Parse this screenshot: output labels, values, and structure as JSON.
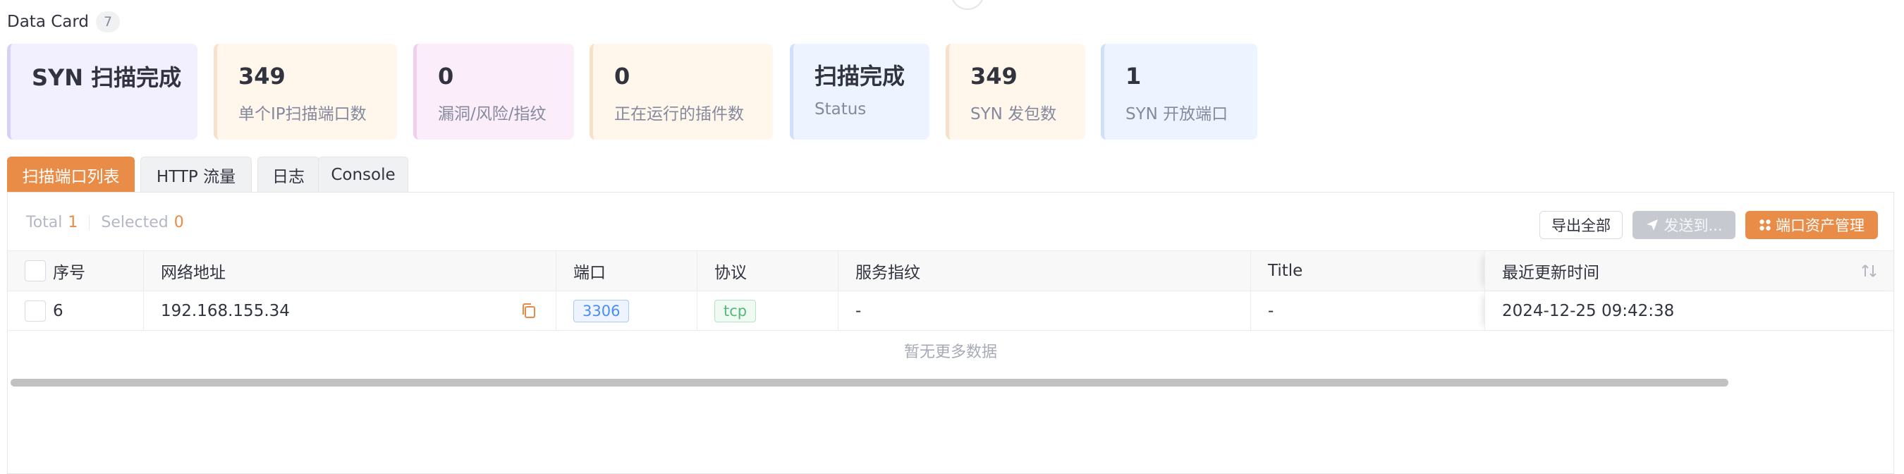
{
  "header": {
    "title": "Data Card",
    "count": "7"
  },
  "cards": [
    {
      "value": "SYN 扫描完成",
      "label": ""
    },
    {
      "value": "349",
      "label": "单个IP扫描端口数"
    },
    {
      "value": "0",
      "label": "漏洞/风险/指纹"
    },
    {
      "value": "0",
      "label": "正在运行的插件数"
    },
    {
      "value": "扫描完成",
      "label": "Status"
    },
    {
      "value": "349",
      "label": "SYN 发包数"
    },
    {
      "value": "1",
      "label": "SYN 开放端口"
    }
  ],
  "tabs": [
    "扫描端口列表",
    "HTTP 流量",
    "日志",
    "Console"
  ],
  "stats": {
    "total_label": "Total",
    "total": "1",
    "selected_label": "Selected",
    "selected": "0"
  },
  "buttons": {
    "export": "导出全部",
    "send": "发送到...",
    "asset": "端口资产管理"
  },
  "table": {
    "columns": [
      "序号",
      "网络地址",
      "端口",
      "协议",
      "服务指纹",
      "Title",
      "最近更新时间"
    ],
    "rows": [
      {
        "index": "6",
        "address": "192.168.155.34",
        "port": "3306",
        "protocol": "tcp",
        "fingerprint": "-",
        "title": "-",
        "updated": "2024-12-25 09:42:38"
      }
    ],
    "empty_text": "暂无更多数据"
  },
  "colors": {
    "accent": "#e98c47",
    "purple_card": "#f2efff",
    "orange_card": "#fff6ec",
    "pink_card": "#fbeefa",
    "blue_card": "#edf4ff"
  }
}
